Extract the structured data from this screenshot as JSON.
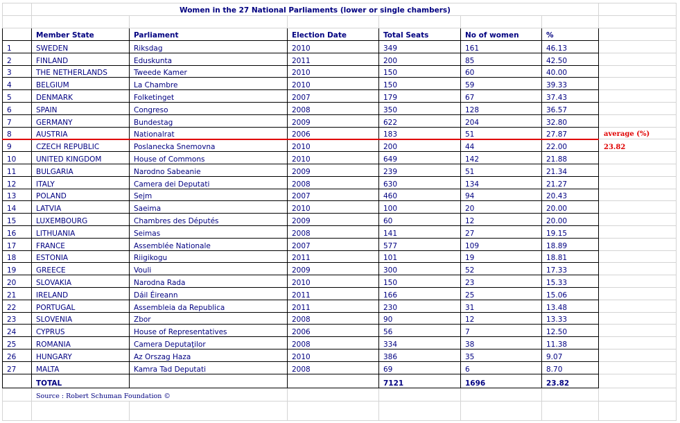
{
  "title": "Women in the 27 National Parliaments (lower or single chambers)",
  "headers": {
    "member_state": "Member State",
    "parliament": "Parliament",
    "election_date": "Election Date",
    "total_seats": "Total Seats",
    "no_of_women": "No of women",
    "percent": "%"
  },
  "rows": [
    {
      "n": "1",
      "state": "SWEDEN",
      "parliament": "Riksdag",
      "date": "2010",
      "seats": "349",
      "women": "161",
      "pct": "46.13"
    },
    {
      "n": "2",
      "state": "FINLAND",
      "parliament": "Eduskunta",
      "date": "2011",
      "seats": "200",
      "women": "85",
      "pct": "42.50"
    },
    {
      "n": "3",
      "state": "THE NETHERLANDS",
      "parliament": "Tweede Kamer",
      "date": "2010",
      "seats": "150",
      "women": "60",
      "pct": "40.00"
    },
    {
      "n": "4",
      "state": "BELGIUM",
      "parliament": "La Chambre",
      "date": "2010",
      "seats": "150",
      "women": "59",
      "pct": "39.33"
    },
    {
      "n": "5",
      "state": "DENMARK",
      "parliament": "Folketinget",
      "date": "2007",
      "seats": "179",
      "women": "67",
      "pct": "37.43"
    },
    {
      "n": "6",
      "state": "SPAIN",
      "parliament": "Congreso",
      "date": "2008",
      "seats": "350",
      "women": "128",
      "pct": "36.57"
    },
    {
      "n": "7",
      "state": "GERMANY",
      "parliament": "Bundestag",
      "date": "2009",
      "seats": "622",
      "women": "204",
      "pct": "32.80"
    },
    {
      "n": "8",
      "state": "AUSTRIA",
      "parliament": "Nationalrat",
      "date": "2006",
      "seats": "183",
      "women": "51",
      "pct": "27.87"
    },
    {
      "n": "9",
      "state": "CZECH REPUBLIC",
      "parliament": "Poslanecka Snemovna",
      "date": "2010",
      "seats": "200",
      "women": "44",
      "pct": "22.00"
    },
    {
      "n": "10",
      "state": "UNITED KINGDOM",
      "parliament": "House of Commons",
      "date": "2010",
      "seats": "649",
      "women": "142",
      "pct": "21.88"
    },
    {
      "n": "11",
      "state": "BULGARIA",
      "parliament": "Narodno Sabeanie",
      "date": "2009",
      "seats": "239",
      "women": "51",
      "pct": "21.34"
    },
    {
      "n": "12",
      "state": "ITALY",
      "parliament": "Camera dei Deputati",
      "date": "2008",
      "seats": "630",
      "women": "134",
      "pct": "21.27"
    },
    {
      "n": "13",
      "state": "POLAND",
      "parliament": "Sejm",
      "date": "2007",
      "seats": "460",
      "women": "94",
      "pct": "20.43"
    },
    {
      "n": "14",
      "state": "LATVIA",
      "parliament": "Saeima",
      "date": "2010",
      "seats": "100",
      "women": "20",
      "pct": "20.00"
    },
    {
      "n": "15",
      "state": "LUXEMBOURG",
      "parliament": "Chambres des Députés",
      "date": "2009",
      "seats": "60",
      "women": "12",
      "pct": "20.00"
    },
    {
      "n": "16",
      "state": "LITHUANIA",
      "parliament": "Seimas",
      "date": "2008",
      "seats": "141",
      "women": "27",
      "pct": "19.15"
    },
    {
      "n": "17",
      "state": "FRANCE",
      "parliament": "Assemblée Nationale",
      "date": "2007",
      "seats": "577",
      "women": "109",
      "pct": "18.89"
    },
    {
      "n": "18",
      "state": "ESTONIA",
      "parliament": "Riigikogu",
      "date": "2011",
      "seats": "101",
      "women": "19",
      "pct": "18.81"
    },
    {
      "n": "19",
      "state": "GREECE",
      "parliament": "Vouli",
      "date": "2009",
      "seats": "300",
      "women": "52",
      "pct": "17.33"
    },
    {
      "n": "20",
      "state": "SLOVAKIA",
      "parliament": "Narodna Rada",
      "date": "2010",
      "seats": "150",
      "women": "23",
      "pct": "15.33"
    },
    {
      "n": "21",
      "state": "IRELAND",
      "parliament": "Dáil Éireann",
      "date": "2011",
      "seats": "166",
      "women": "25",
      "pct": "15.06"
    },
    {
      "n": "22",
      "state": "PORTUGAL",
      "parliament": "Assembleia da Republica",
      "date": "2011",
      "seats": "230",
      "women": "31",
      "pct": "13.48"
    },
    {
      "n": "23",
      "state": "SLOVENIA",
      "parliament": "Zbor",
      "date": "2008",
      "seats": "90",
      "women": "12",
      "pct": "13.33"
    },
    {
      "n": "24",
      "state": "CYPRUS",
      "parliament": "House of Representatives",
      "date": "2006",
      "seats": "56",
      "women": "7",
      "pct": "12.50"
    },
    {
      "n": "25",
      "state": "ROMANIA",
      "parliament": "Camera Deputaţilor",
      "date": "2008",
      "seats": "334",
      "women": "38",
      "pct": "11.38"
    },
    {
      "n": "26",
      "state": "HUNGARY",
      "parliament": "Az Orszag Haza",
      "date": "2010",
      "seats": "386",
      "women": "35",
      "pct": "9.07"
    },
    {
      "n": "27",
      "state": "MALTA",
      "parliament": "Kamra Tad Deputati",
      "date": "2008",
      "seats": "69",
      "women": "6",
      "pct": "8.70"
    }
  ],
  "total": {
    "label": "TOTAL",
    "seats": "7121",
    "women": "1696",
    "pct": "23.82"
  },
  "average": {
    "label": "average (%)",
    "value": "23.82"
  },
  "source": "Source : Robert Schuman Foundation ©",
  "colors": {
    "text": "#000080",
    "average_line": "#e00000",
    "grid": "#d4d4d4"
  }
}
